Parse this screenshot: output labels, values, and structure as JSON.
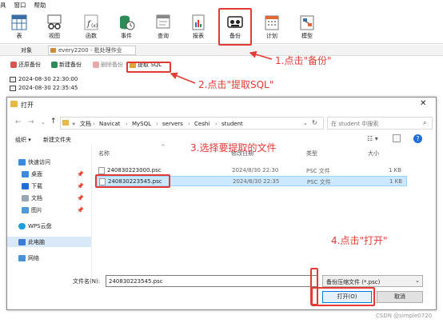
{
  "menu": {
    "m1": "具",
    "m2": "窗口",
    "m3": "帮助"
  },
  "ribbon": [
    {
      "label": "表",
      "icon": "table-icon"
    },
    {
      "label": "视图",
      "icon": "view-icon"
    },
    {
      "label": "函数",
      "icon": "function-icon"
    },
    {
      "label": "事件",
      "icon": "event-icon"
    },
    {
      "label": "查询",
      "icon": "query-icon"
    },
    {
      "label": "报表",
      "icon": "report-icon"
    },
    {
      "label": "备份",
      "icon": "backup-icon"
    },
    {
      "label": "计划",
      "icon": "schedule-icon"
    },
    {
      "label": "模型",
      "icon": "model-icon"
    }
  ],
  "tabs": {
    "object": "对象",
    "conn": "every2200 - 批处理作业"
  },
  "toolbar": {
    "restore": "还原备份",
    "new": "新建备份",
    "delete": "删除备份",
    "extract": "提取 SQL"
  },
  "backups": [
    "2024-08-30 22:30:00",
    "2024-08-30 22:35:45"
  ],
  "dialog": {
    "title": "打开",
    "breadcrumb": [
      "«",
      "文档",
      "Navicat",
      "MySQL",
      "servers",
      "Ceshi",
      "student"
    ],
    "search_placeholder": "在 student 中搜索",
    "organize": "组织 ▾",
    "new_folder": "新建文件夹",
    "sidebar": [
      {
        "label": "快速访问",
        "icon": "star-icon"
      },
      {
        "label": "桌面",
        "icon": "desktop-icon"
      },
      {
        "label": "下载",
        "icon": "download-icon"
      },
      {
        "label": "文档",
        "icon": "document-icon"
      },
      {
        "label": "图片",
        "icon": "picture-icon"
      },
      {
        "label": "WPS云盘",
        "icon": "cloud-icon"
      },
      {
        "label": "此电脑",
        "icon": "computer-icon"
      },
      {
        "label": "网络",
        "icon": "network-icon"
      }
    ],
    "columns": {
      "name": "名称",
      "date": "修改日期",
      "type": "类型",
      "size": "大小"
    },
    "files": [
      {
        "name": "240830223000.psc",
        "date": "2024/8/30 22:30",
        "type": "PSC 文件",
        "size": "1 KB"
      },
      {
        "name": "240830223545.psc",
        "date": "2024/8/30 22:35",
        "type": "PSC 文件",
        "size": "1 KB"
      }
    ],
    "filename_label": "文件名(N):",
    "filename_value": "240830223545.psc",
    "filetype": "备份压缩文件 (*.psc)",
    "open": "打开(O)",
    "cancel": "取消"
  },
  "annotations": {
    "a1": "1.点击\"备份\"",
    "a2": "2.点击\"提取SQL\"",
    "a3": "3.选择要提取的文件",
    "a4": "4.点击\"打开\""
  },
  "watermark": "CSDN @simple0720",
  "colors": {
    "accent": "#e53935",
    "selected": "#cce8ff"
  }
}
